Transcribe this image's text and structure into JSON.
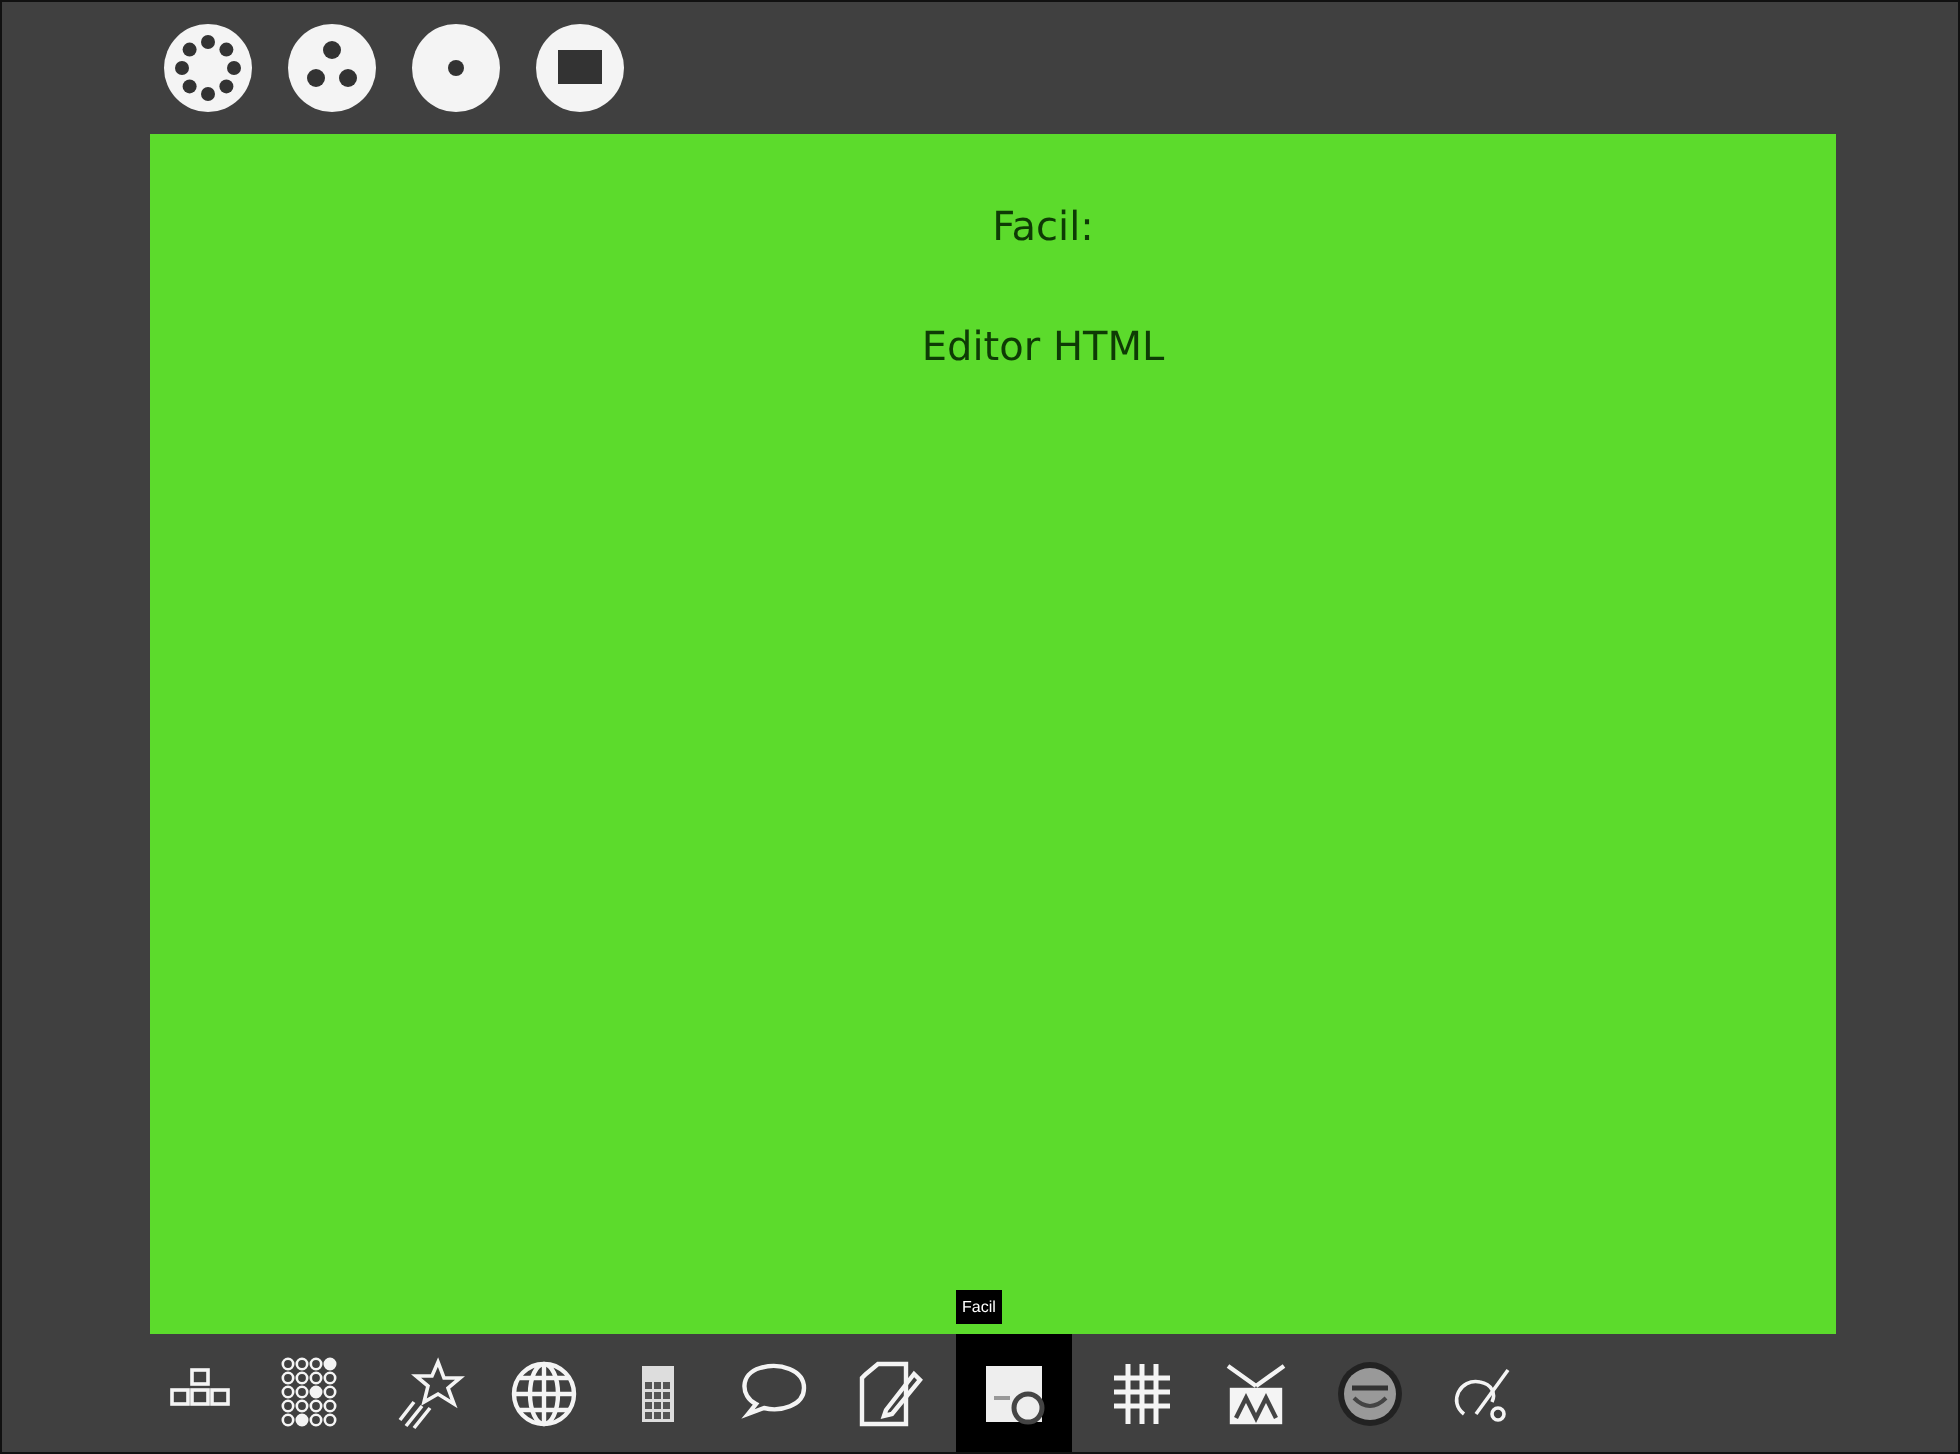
{
  "zoom_buttons": [
    {
      "kind": "neighborhood"
    },
    {
      "kind": "group"
    },
    {
      "kind": "home"
    },
    {
      "kind": "activity"
    }
  ],
  "panel": {
    "title": "Facil:",
    "description": "Editor HTML"
  },
  "activities": [
    {
      "selected": false
    },
    {
      "selected": false
    },
    {
      "selected": false
    },
    {
      "selected": false
    },
    {
      "selected": false
    },
    {
      "selected": false
    },
    {
      "selected": false
    },
    {
      "selected": true,
      "tooltip": "Facil"
    },
    {
      "selected": false
    },
    {
      "selected": false
    },
    {
      "selected": false
    },
    {
      "selected": false
    }
  ]
}
